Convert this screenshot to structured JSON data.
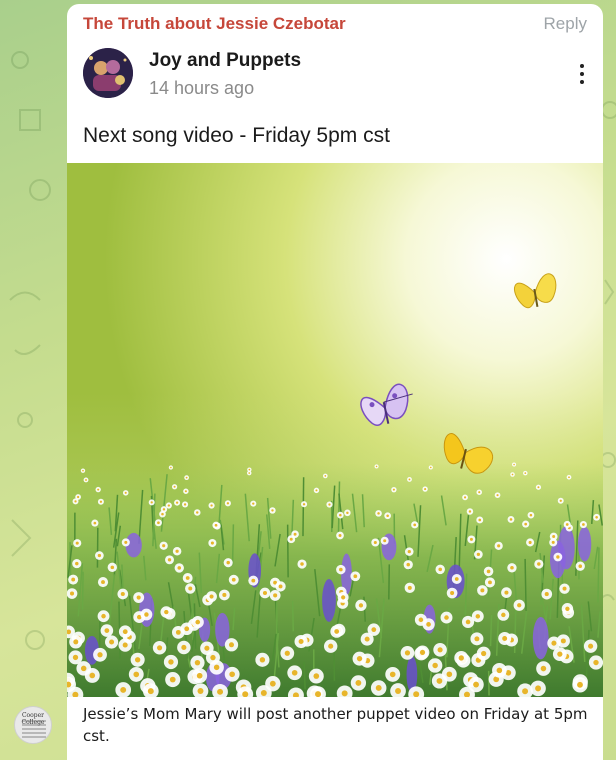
{
  "reply": {
    "title": "The Truth about Jessie Czebotar",
    "action_label": "Reply"
  },
  "post": {
    "channel_name": "Joy and Puppets",
    "time": "14 hours ago",
    "text": "Next song video - Friday 5pm cst",
    "menu_icon": "kebab-menu-icon",
    "media_icons": [
      "butterfly-icon",
      "butterfly-icon",
      "butterfly-icon"
    ],
    "caption": "Jessie’s Mom Mary will post another puppet video on Friday at 5pm cst."
  },
  "sender": {
    "avatar_text": "Cooper College"
  },
  "colors": {
    "reply_title": "#c6473a",
    "muted_text": "#8a8a8a",
    "reply_action": "#9ea4a8",
    "background_top": "#a9cf8c",
    "background_bottom": "#d7e59a"
  }
}
